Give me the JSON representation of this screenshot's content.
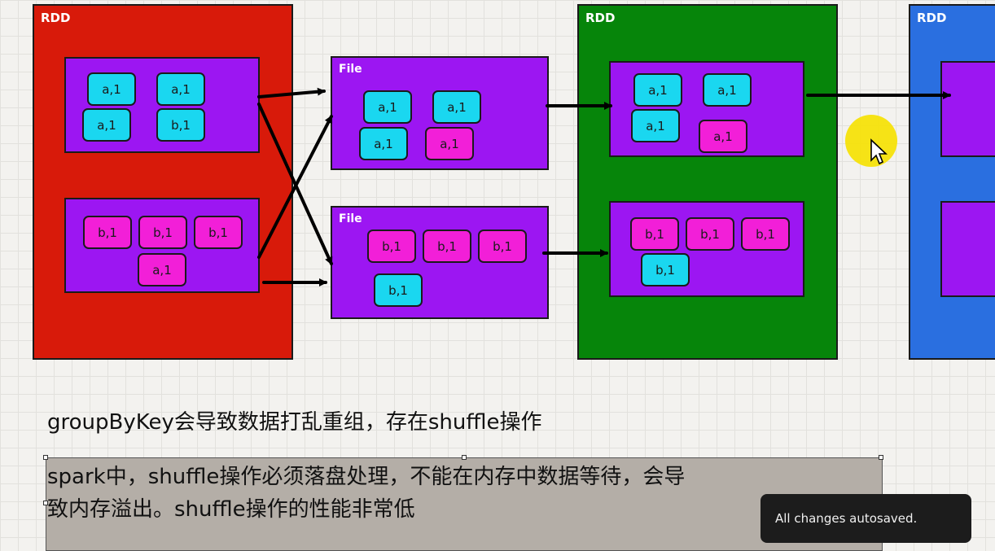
{
  "rdd_label": "RDD",
  "file_label": "File",
  "rdd_colors": {
    "red": "#d81a0a",
    "green": "#06850a",
    "blue": "#2a6fe0"
  },
  "cells": {
    "a": "a,1",
    "b": "b,1"
  },
  "text": {
    "line1": "groupByKey会导致数据打乱重组，存在shuffle操作",
    "line2a": "spark中，shuffle操作必须落盘处理，不能在内存中数据等待，会导",
    "line2b": "致内存溢出。shuffle操作的性能非常低"
  },
  "toast": "All changes autosaved.",
  "cursor_icon": "pointer-arrow-icon"
}
